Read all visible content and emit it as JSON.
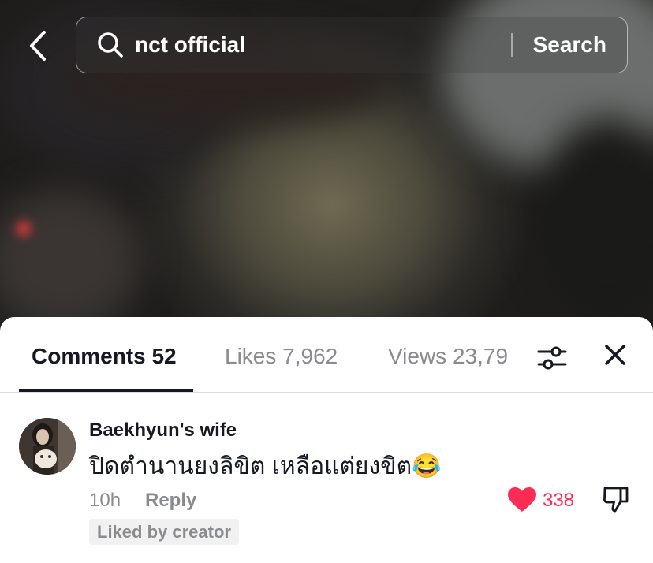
{
  "search": {
    "query": "nct official",
    "button_label": "Search"
  },
  "tabs": [
    {
      "label": "Comments 52"
    },
    {
      "label": "Likes 7,962"
    },
    {
      "label": "Views 23,79"
    }
  ],
  "comment": {
    "username": "Baekhyun's wife",
    "text": "ปิดตำนานยงลิขิต เหลือแต่ยงขิต😂",
    "time": "10h",
    "reply_label": "Reply",
    "like_count": "338",
    "badge": "Liked by creator"
  },
  "icons": {
    "back": "chevron-left-icon",
    "search": "search-icon",
    "filter": "sliders-icon",
    "close": "close-icon",
    "like": "heart-icon",
    "dislike": "thumbs-down-icon"
  },
  "colors": {
    "accent_like": "#fe2c55",
    "text_primary": "#161823",
    "text_secondary": "#8a8b91"
  }
}
